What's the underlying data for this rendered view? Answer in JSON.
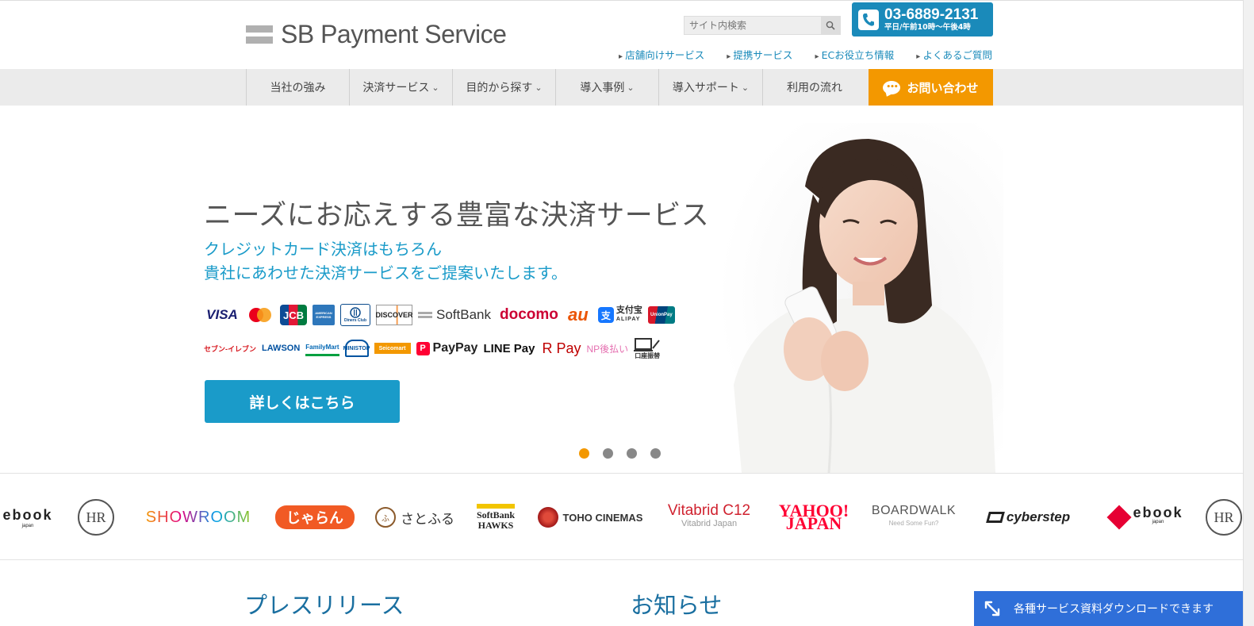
{
  "header": {
    "logo_text": "SB Payment Service",
    "search_placeholder": "サイト内検索",
    "tel_number": "03-6889-2131",
    "tel_hours": "平日/午前10時～午後4時",
    "sublinks": [
      "店舗向けサービス",
      "提携サービス",
      "ECお役立ち情報",
      "よくあるご質問"
    ]
  },
  "nav": {
    "items": [
      "当社の強み",
      "決済サービス",
      "目的から探す",
      "導入事例",
      "導入サポート",
      "利用の流れ"
    ],
    "contact_label": "お問い合わせ"
  },
  "hero": {
    "title": "ニーズにお応えする豊富な決済サービス",
    "subtitle_line1": "クレジットカード決済はもちろん",
    "subtitle_line2": "貴社にあわせた決済サービスをご提案いたします。",
    "cta_label": "詳しくはこちら",
    "slides": 4,
    "active_slide": 1,
    "payment_row1": [
      "VISA",
      "Mastercard",
      "JCB",
      "AMERICAN EXPRESS",
      "Diners Club",
      "DISCOVER",
      "SoftBank",
      "docomo",
      "au",
      "支付宝",
      "UnionPay"
    ],
    "payment_row2": [
      "セブン-イレブン",
      "LAWSON",
      "FamilyMart",
      "MINISTOP",
      "Seicomart",
      "PayPay",
      "LINE Pay",
      "R Pay",
      "NP後払い",
      "口座振替"
    ]
  },
  "clients": [
    "ebook",
    "HR",
    "SHOWROOM",
    "じゃらん",
    "さとふる",
    "SoftBank HAWKS",
    "TOHO CINEMAS",
    "Vitabrid C12",
    "Vitabrid Japan",
    "YAHOO! JAPAN",
    "BOARDWALK",
    "Need Some Fun?",
    "cyberstep",
    "ebook",
    "HR"
  ],
  "sections": {
    "press": "プレスリリース",
    "news": "お知らせ"
  },
  "download_bar": "各種サービス資料ダウンロードできます",
  "colors": {
    "accent_blue": "#1a9bc9",
    "tel_blue": "#1a8aba",
    "orange": "#f39800",
    "download_blue": "#2f6fd9"
  }
}
